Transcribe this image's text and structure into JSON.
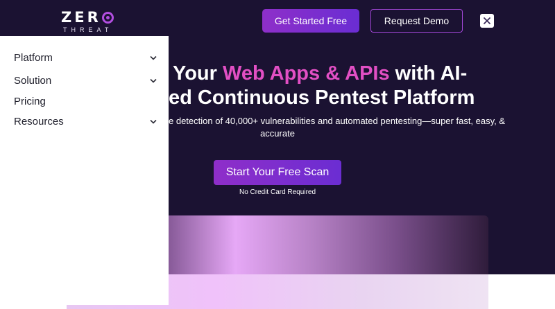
{
  "brand": {
    "logo_top": "ZER",
    "logo_bottom": "THREAT",
    "accent": "#b24ee0"
  },
  "header": {
    "get_started_label": "Get Started Free",
    "request_demo_label": "Request Demo",
    "close_icon": "close-icon"
  },
  "menu": {
    "items": [
      {
        "label": "Platform",
        "has_children": true
      },
      {
        "label": "Solution",
        "has_children": true
      },
      {
        "label": "Pricing",
        "has_children": false
      },
      {
        "label": "Resources",
        "has_children": true
      }
    ]
  },
  "hero": {
    "title_pre": "Your ",
    "title_accent": "Web Apps & APIs",
    "title_post": " with AI-",
    "title_line2": "ed Continuous Pentest Platform",
    "subtitle_line1": "e detection of 40,000+ vulnerabilities and automated pentesting—super fast, easy, &",
    "subtitle_line2": "accurate",
    "cta_label": "Start Your Free Scan",
    "cta_note": "No Credit Card Required",
    "accent_color": "#e24fc4"
  }
}
